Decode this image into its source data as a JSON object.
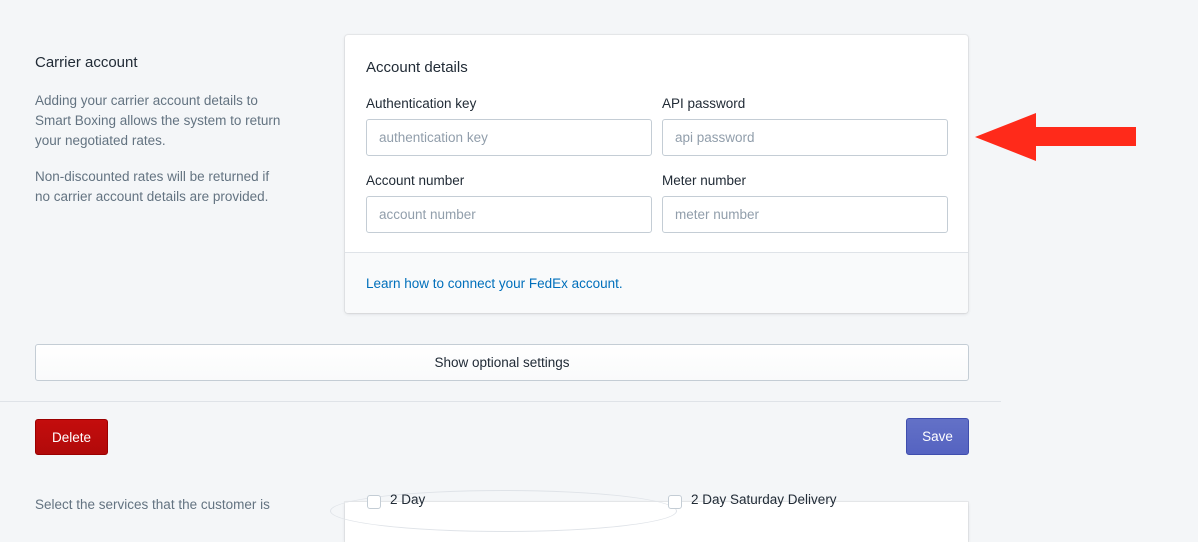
{
  "section": {
    "title": "Carrier account",
    "description_1": "Adding your carrier account details to Smart Boxing allows the system to return your negotiated rates.",
    "description_2": "Non-discounted rates will be returned if no carrier account details are provided."
  },
  "account_details": {
    "title": "Account details",
    "fields": [
      {
        "label": "Authentication key",
        "placeholder": "authentication key",
        "value": ""
      },
      {
        "label": "API password",
        "placeholder": "api password",
        "value": ""
      },
      {
        "label": "Account number",
        "placeholder": "account number",
        "value": ""
      },
      {
        "label": "Meter number",
        "placeholder": "meter number",
        "value": ""
      }
    ],
    "footer_link": "Learn how to connect your FedEx account."
  },
  "optional_settings_label": "Show optional settings",
  "actions": {
    "delete_label": "Delete",
    "save_label": "Save"
  },
  "peek": {
    "text": "Select the services that the customer is",
    "checkbox_1_label": "2 Day",
    "checkbox_2_label": "2 Day Saturday Delivery"
  },
  "colors": {
    "background": "#f4f6f8",
    "link": "#006fbb",
    "delete": "#bf0711",
    "save": "#5c6ac4",
    "annotation_arrow": "#ff2a1a"
  },
  "icons": {
    "annotation": "red-arrow-left-icon"
  }
}
